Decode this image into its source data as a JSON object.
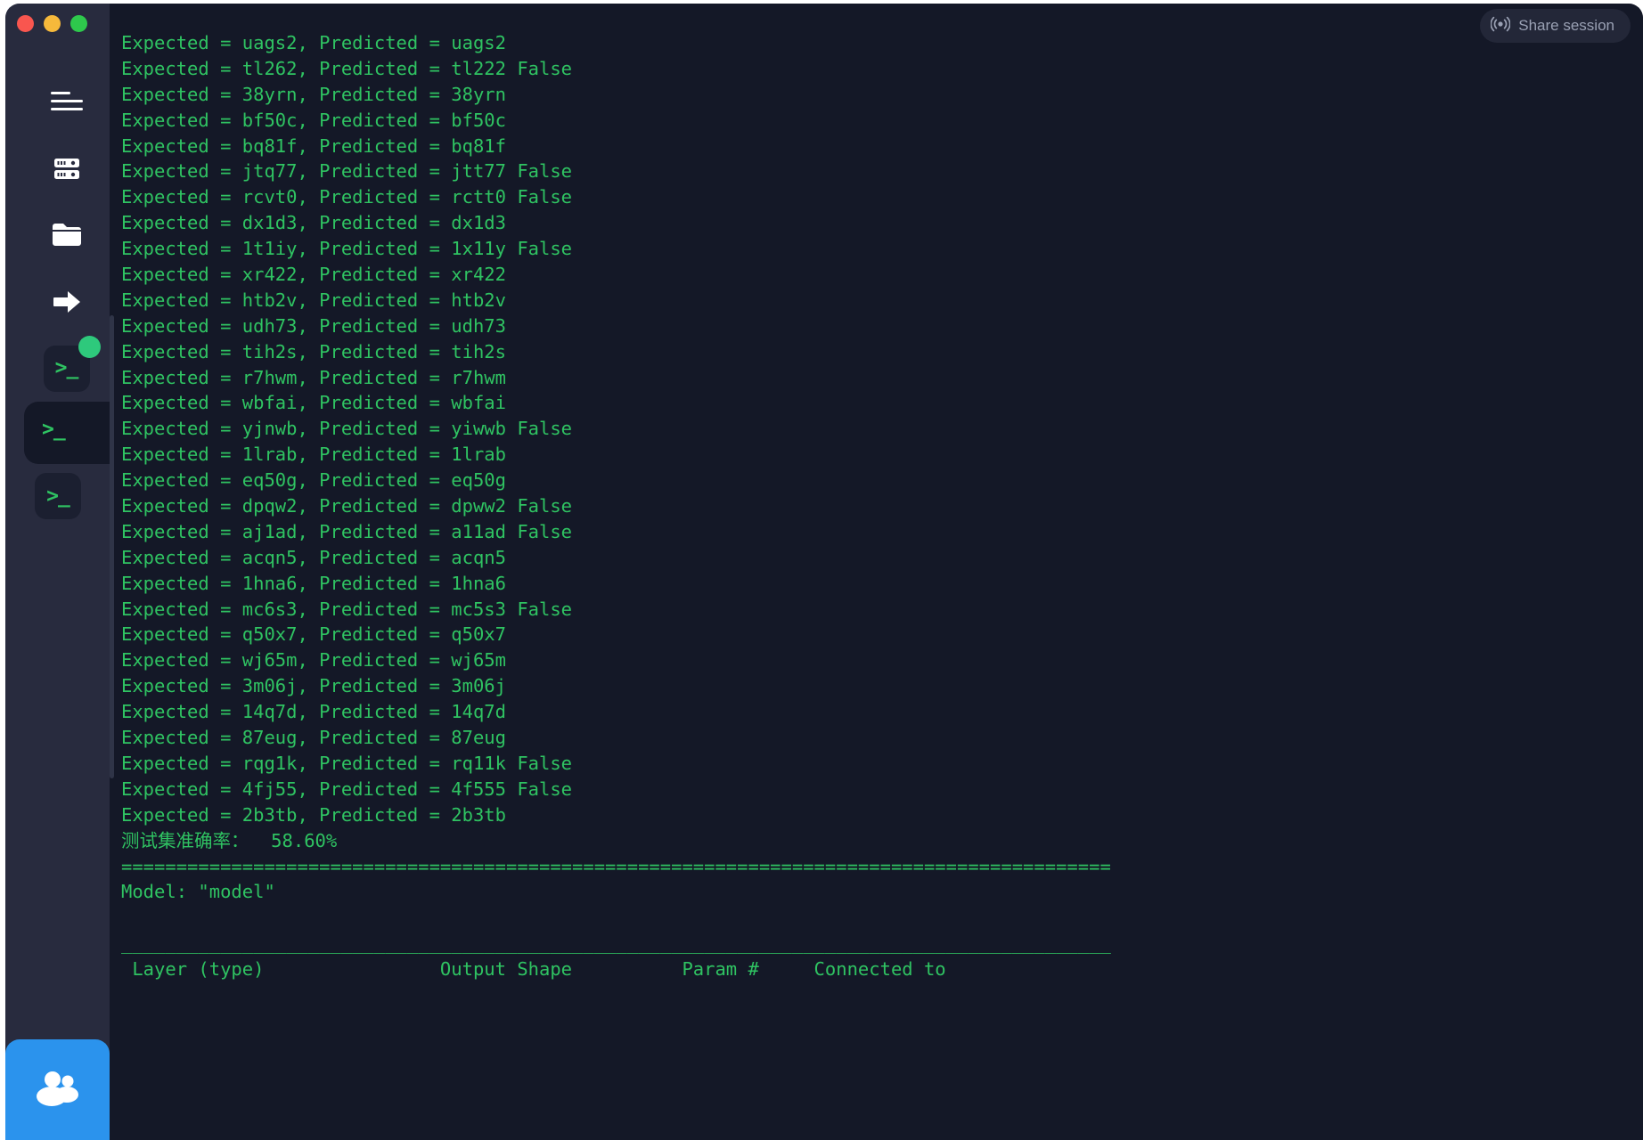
{
  "window": {
    "traffic_lights": [
      {
        "name": "close",
        "color": "#f9564f"
      },
      {
        "name": "minimize",
        "color": "#f6b93b"
      },
      {
        "name": "maximize",
        "color": "#2ec94c"
      }
    ]
  },
  "header": {
    "share_label": "Share session",
    "share_icon": "broadcast-icon"
  },
  "sidebar": {
    "background": "#282b3e",
    "items": [
      {
        "name": "menu",
        "icon": "hamburger-icon"
      },
      {
        "name": "servers",
        "icon": "server-rack-icon"
      },
      {
        "name": "files",
        "icon": "folder-icon"
      },
      {
        "name": "transfer",
        "icon": "forward-arrow-icon"
      },
      {
        "name": "terminal-session-1",
        "icon": "terminal-prompt-icon",
        "glyph": ">_",
        "status": "connected"
      },
      {
        "name": "terminal-session-2",
        "icon": "terminal-prompt-icon",
        "glyph": ">_",
        "active": true
      },
      {
        "name": "terminal-session-3",
        "icon": "terminal-prompt-icon",
        "glyph": ">_"
      }
    ],
    "users_button": {
      "name": "share-users-button",
      "icon": "users-icon",
      "color": "#2b93ed"
    }
  },
  "terminal": {
    "background": "#141827",
    "text_color": "#2fc362",
    "lines": [
      "Expected = uags2, Predicted = uags2",
      "Expected = tl262, Predicted = tl222 False",
      "Expected = 38yrn, Predicted = 38yrn",
      "Expected = bf50c, Predicted = bf50c",
      "Expected = bq81f, Predicted = bq81f",
      "Expected = jtq77, Predicted = jtt77 False",
      "Expected = rcvt0, Predicted = rctt0 False",
      "Expected = dx1d3, Predicted = dx1d3",
      "Expected = 1t1iy, Predicted = 1x11y False",
      "Expected = xr422, Predicted = xr422",
      "Expected = htb2v, Predicted = htb2v",
      "Expected = udh73, Predicted = udh73",
      "Expected = tih2s, Predicted = tih2s",
      "Expected = r7hwm, Predicted = r7hwm",
      "Expected = wbfai, Predicted = wbfai",
      "Expected = yjnwb, Predicted = yiwwb False",
      "Expected = 1lrab, Predicted = 1lrab",
      "Expected = eq50g, Predicted = eq50g",
      "Expected = dpqw2, Predicted = dpww2 False",
      "Expected = aj1ad, Predicted = a11ad False",
      "Expected = acqn5, Predicted = acqn5",
      "Expected = 1hna6, Predicted = 1hna6",
      "Expected = mc6s3, Predicted = mc5s3 False",
      "Expected = q50x7, Predicted = q50x7",
      "Expected = wj65m, Predicted = wj65m",
      "Expected = 3m06j, Predicted = 3m06j",
      "Expected = 14q7d, Predicted = 14q7d",
      "Expected = 87eug, Predicted = 87eug",
      "Expected = rqg1k, Predicted = rq11k False",
      "Expected = 4fj55, Predicted = 4f555 False",
      "Expected = 2b3tb, Predicted = 2b3tb",
      "测试集准确率：  58.60%",
      "==========================================================================================",
      "Model: \"model\"",
      "",
      "__________________________________________________________________________________________",
      " Layer (type)                Output Shape          Param #     Connected to"
    ],
    "accuracy_label": "测试集准确率：",
    "accuracy_value": "58.60%",
    "model_name": "Model: \"model\"",
    "table_headers": [
      "Layer (type)",
      "Output Shape",
      "Param #",
      "Connected to"
    ]
  }
}
